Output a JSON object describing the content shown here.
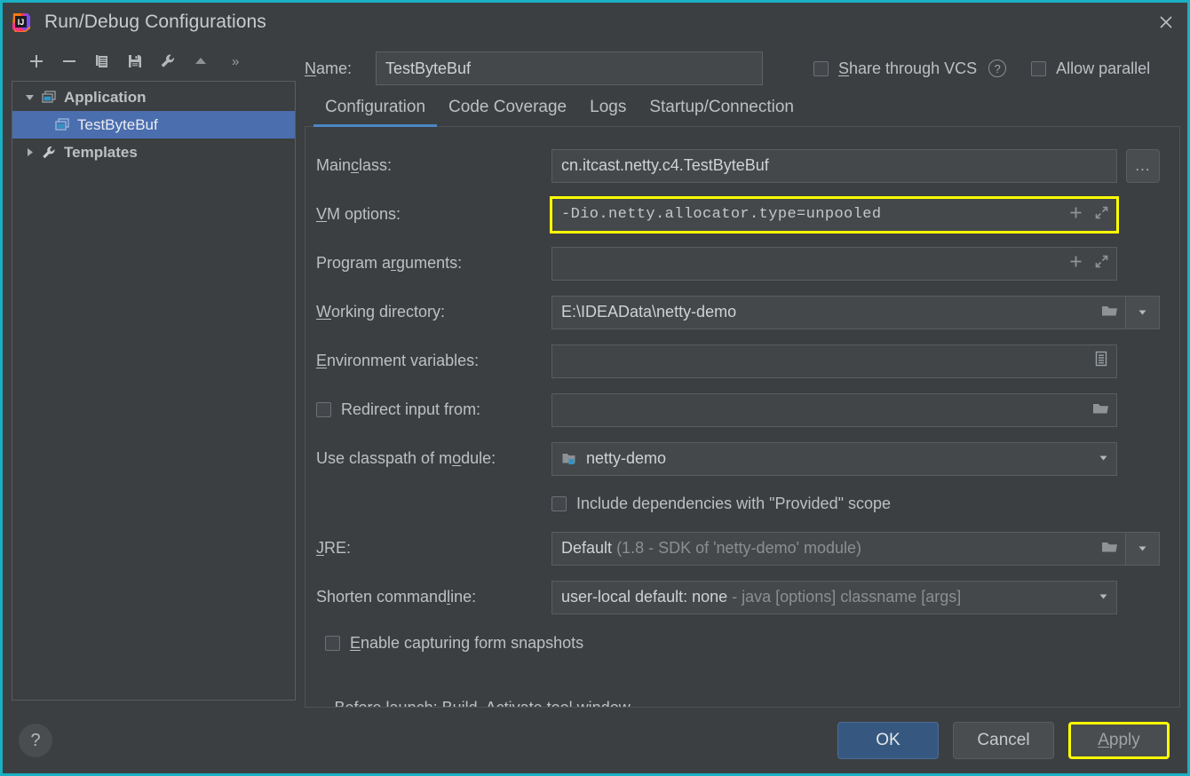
{
  "window": {
    "title": "Run/Debug Configurations",
    "logo_icon": "intellij-idea-logo",
    "close_icon": "close-icon",
    "accent_border": "#19b0c4"
  },
  "left_panel": {
    "toolbar": [
      {
        "name": "add-configuration-button",
        "icon": "plus-icon",
        "label": "+"
      },
      {
        "name": "remove-configuration-button",
        "icon": "minus-icon",
        "label": "−"
      },
      {
        "name": "copy-configuration-button",
        "icon": "copy-icon",
        "label": ""
      },
      {
        "name": "save-configuration-button",
        "icon": "save-icon",
        "label": ""
      },
      {
        "name": "edit-templates-button",
        "icon": "wrench-icon",
        "label": ""
      },
      {
        "name": "move-up-button",
        "icon": "triangle-up-icon",
        "label": ""
      }
    ],
    "overflow_label": "»",
    "tree": [
      {
        "label": "Application",
        "icon": "application-icon",
        "twisty": "expanded",
        "selected": false,
        "child": false
      },
      {
        "label": "TestByteBuf",
        "icon": "application-icon",
        "twisty": "none",
        "selected": true,
        "child": true
      },
      {
        "label": "Templates",
        "icon": "wrench-icon",
        "twisty": "collapsed",
        "selected": false,
        "child": false
      }
    ]
  },
  "header": {
    "name_label": "Name:",
    "name_value": "TestByteBuf",
    "share_vcs_label": "Share through VCS",
    "share_vcs_checked": false,
    "help_icon": "question-mark-icon",
    "allow_parallel_label": "Allow parallel",
    "allow_parallel_checked": false
  },
  "tabs": [
    {
      "label": "Configuration",
      "active": true
    },
    {
      "label": "Code Coverage",
      "active": false
    },
    {
      "label": "Logs",
      "active": false
    },
    {
      "label": "Startup/Connection",
      "active": false
    }
  ],
  "form": {
    "main_class": {
      "label": "Main class:",
      "value": "cn.itcast.netty.c4.TestByteBuf",
      "browse_label": "..."
    },
    "vm_options": {
      "label": "VM options:",
      "value": "-Dio.netty.allocator.type=unpooled",
      "highlighted": true,
      "icons": [
        "plus-icon",
        "expand-icon"
      ]
    },
    "program_arguments": {
      "label": "Program arguments:",
      "value": "",
      "icons": [
        "plus-icon",
        "expand-icon"
      ]
    },
    "working_directory": {
      "label": "Working directory:",
      "value": "E:\\IDEAData\\netty-demo",
      "icons": [
        "folder-icon"
      ],
      "dropdown": true
    },
    "environment_variables": {
      "label": "Environment variables:",
      "value": "",
      "icons": [
        "list-icon"
      ]
    },
    "redirect_input": {
      "label": "Redirect input from:",
      "checked": false,
      "value": "",
      "icons": [
        "folder-icon"
      ]
    },
    "classpath_module": {
      "label": "Use classpath of module:",
      "value": "netty-demo",
      "icon": "module-icon",
      "dropdown": true
    },
    "include_provided": {
      "label": "Include dependencies with \"Provided\" scope",
      "checked": false
    },
    "jre": {
      "label": "JRE:",
      "value": "Default",
      "value_dim": "(1.8 - SDK of 'netty-demo' module)",
      "icons": [
        "folder-icon"
      ],
      "dropdown": true
    },
    "shorten_command_line": {
      "label": "Shorten command line:",
      "value": "user-local default: none",
      "value_dim": "- java [options] classname [args]",
      "dropdown": true
    },
    "form_snapshots": {
      "label": "Enable capturing form snapshots",
      "checked": false
    },
    "before_launch": {
      "minus": "−",
      "label": "Before launch: Build, Activate tool window"
    }
  },
  "footer": {
    "help_label": "?",
    "ok_label": "OK",
    "cancel_label": "Cancel",
    "apply_label": "Apply",
    "apply_highlighted": true
  }
}
